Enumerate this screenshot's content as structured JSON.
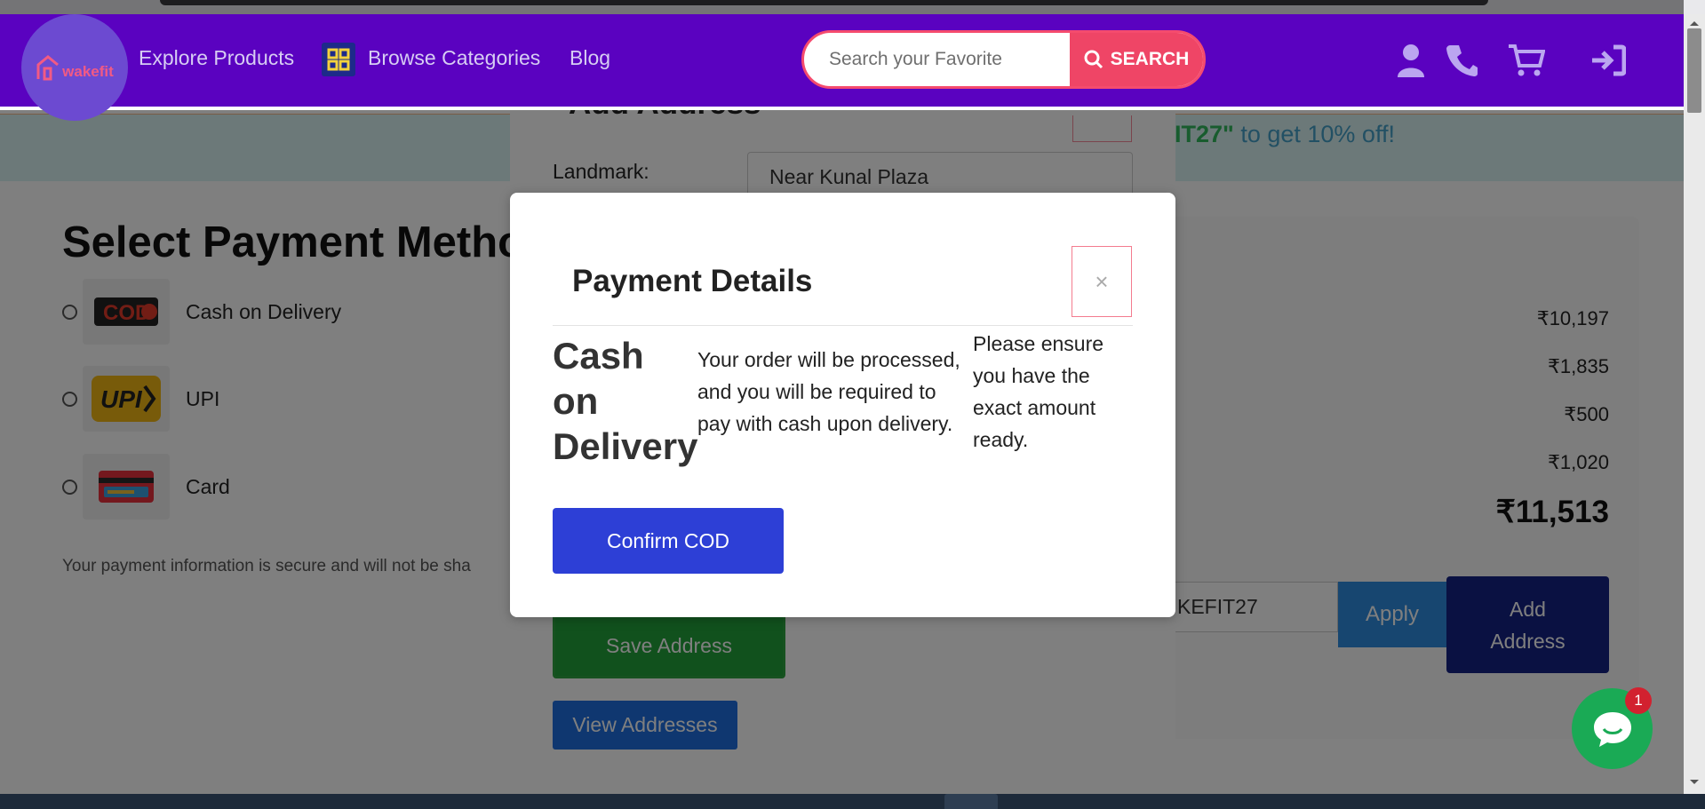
{
  "nav": {
    "logo_text": "wakefit",
    "explore": "Explore Products",
    "browse": "Browse Categories",
    "blog": "Blog",
    "search_placeholder": "Search your Favorite",
    "search_button": "SEARCH",
    "icons": [
      "user-icon",
      "phone-icon",
      "cart-icon",
      "sign-in-icon"
    ]
  },
  "promo": {
    "code_fragment": "IT27\"",
    "text": " to get 10% off!"
  },
  "payment": {
    "title": "Select Payment Metho",
    "options": [
      {
        "label": "Cash on Delivery",
        "icon": "cod-logo"
      },
      {
        "label": "UPI",
        "icon": "upi-logo"
      },
      {
        "label": "Card",
        "icon": "card-logo"
      }
    ],
    "secure_note": "Your payment information is secure and will not be sha"
  },
  "summary": {
    "prices": [
      "₹10,197",
      "₹1,835",
      "₹500",
      "₹1,020"
    ],
    "total": "₹11,513",
    "coupon_value": "KEFIT27",
    "apply_label": "Apply",
    "add_address_line1": "Add",
    "add_address_line2": "Address"
  },
  "address_modal": {
    "title": "Add Address",
    "landmark_label": "Landmark:",
    "landmark_value": "Near Kunal Plaza",
    "save_label": "Save Address",
    "view_label": "View Addresses"
  },
  "payment_modal": {
    "title": "Payment Details",
    "close": "×",
    "method": "Cash on Delivery",
    "description": "Your order will be processed, and you will be required to pay with cash upon delivery.",
    "note": "Please ensure you have the exact amount ready.",
    "confirm_label": "Confirm COD"
  },
  "chat": {
    "badge": "1"
  },
  "colors": {
    "navbar": "#5a02c0",
    "search_accent": "#ef4566",
    "confirm": "#2d3fd6",
    "save": "#23a23a",
    "view": "#1f6fe0",
    "apply": "#2f8de0",
    "add_address": "#152285",
    "chat": "#1aaa55"
  }
}
